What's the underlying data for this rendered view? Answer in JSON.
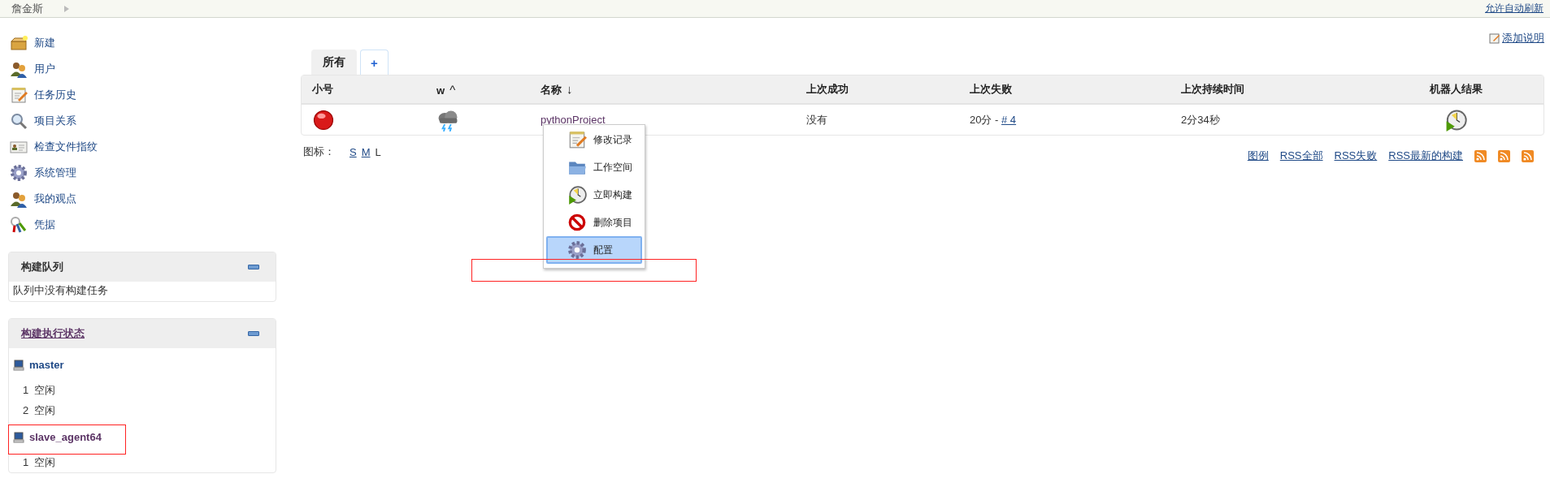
{
  "header": {
    "breadcrumb": "詹金斯",
    "auto_refresh_link": "允许自动刷新"
  },
  "sidebar": {
    "tasks": [
      {
        "label": "新建",
        "kind": "new"
      },
      {
        "label": "用户",
        "kind": "people"
      },
      {
        "label": "任务历史",
        "kind": "notepad"
      },
      {
        "label": "项目关系",
        "kind": "search"
      },
      {
        "label": "检查文件指纹",
        "kind": "card"
      },
      {
        "label": "系统管理",
        "kind": "gear"
      },
      {
        "label": "我的观点",
        "kind": "people"
      },
      {
        "label": "凭据",
        "kind": "keys"
      }
    ]
  },
  "build_queue": {
    "title": "构建队列",
    "message": "队列中没有构建任务"
  },
  "executors": {
    "title": "构建执行状态",
    "nodes": [
      {
        "name": "master",
        "executors": [
          {
            "number": "1",
            "status": "空闲"
          },
          {
            "number": "2",
            "status": "空闲"
          }
        ]
      },
      {
        "name": "slave_agent64",
        "executors": [
          {
            "number": "1",
            "status": "空闲"
          }
        ]
      }
    ]
  },
  "description_link": "添加说明",
  "tabs": [
    {
      "label": "所有",
      "kind": "view",
      "selected": true
    },
    {
      "label": "+",
      "kind": "add",
      "selected": false
    }
  ],
  "table": {
    "columns": [
      {
        "label": "小号"
      },
      {
        "label": "w",
        "sort": "^"
      },
      {
        "label": "名称",
        "sort": "↓"
      },
      {
        "label": "上次成功"
      },
      {
        "label": "上次失败"
      },
      {
        "label": "上次持续时间"
      },
      {
        "label": "机器人结果"
      }
    ],
    "rows": [
      {
        "status_icon": {
          "kind": "failed"
        },
        "weather_icon": {
          "kind": "storm"
        },
        "name": "pythonProject",
        "last_success": "没有",
        "last_failure": "20分 - ",
        "last_failure_build": "# 4",
        "last_duration": "2分34秒",
        "robot_icon": {
          "kind": "build"
        }
      }
    ]
  },
  "icon_size": {
    "label": "图标：",
    "sizes": [
      {
        "label": "S",
        "selected": false
      },
      {
        "label": "M",
        "selected": false
      },
      {
        "label": "L",
        "selected": true
      }
    ]
  },
  "feed_links": [
    "图例",
    "RSS全部",
    "RSS失败",
    "RSS最新的构建"
  ],
  "context_menu": {
    "items": [
      {
        "label": "修改记录",
        "kind": "notepad",
        "selected": false
      },
      {
        "label": "工作空间",
        "kind": "folder",
        "selected": false
      },
      {
        "label": "立即构建",
        "kind": "build",
        "selected": false
      },
      {
        "label": "删除项目",
        "kind": "delete",
        "selected": false
      },
      {
        "label": "配置",
        "kind": "gear",
        "selected": true
      }
    ]
  }
}
